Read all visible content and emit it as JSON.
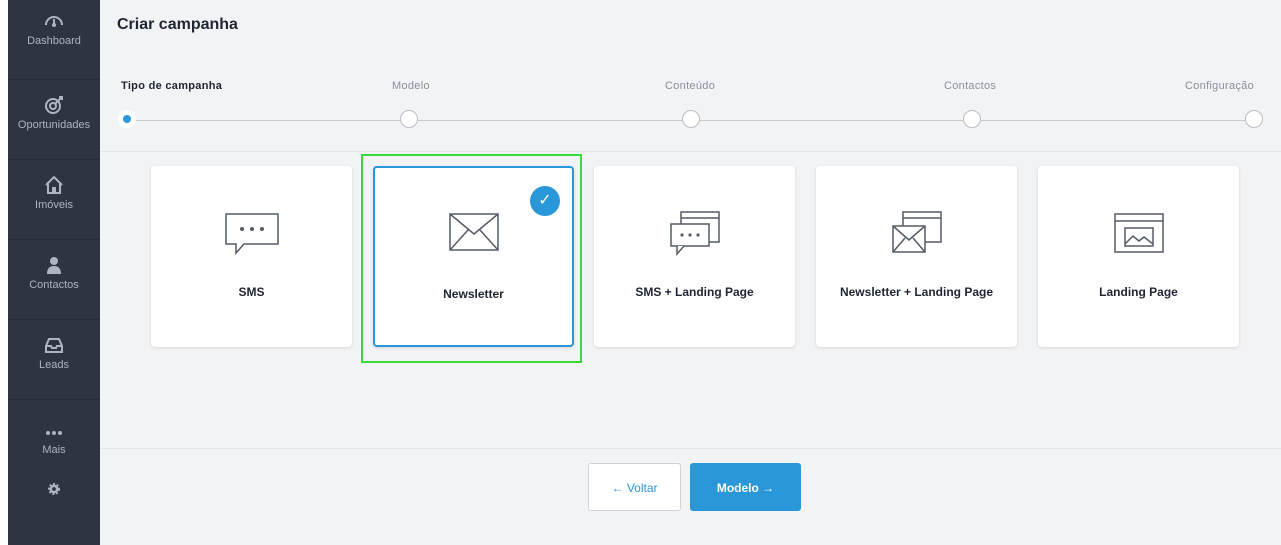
{
  "sidebar": {
    "items": [
      {
        "label": "Dashboard",
        "icon": "dashboard-gauge-icon"
      },
      {
        "label": "Oportunidades",
        "icon": "target-icon"
      },
      {
        "label": "Imóveis",
        "icon": "house-icon"
      },
      {
        "label": "Contactos",
        "icon": "person-icon"
      },
      {
        "label": "Leads",
        "icon": "inbox-icon"
      },
      {
        "label": "Mais",
        "icon": "more-dots-icon"
      }
    ],
    "settings_icon": "gear-icon"
  },
  "header": {
    "title": "Criar campanha"
  },
  "stepper": {
    "steps": [
      {
        "label": "Tipo de campanha",
        "active": true
      },
      {
        "label": "Modelo",
        "active": false
      },
      {
        "label": "Conteúdo",
        "active": false
      },
      {
        "label": "Contactos",
        "active": false
      },
      {
        "label": "Configuração",
        "active": false
      }
    ]
  },
  "campaign_types": [
    {
      "label": "SMS",
      "icon": "sms-chat-icon",
      "selected": false
    },
    {
      "label": "Newsletter",
      "icon": "envelope-icon",
      "selected": true
    },
    {
      "label": "SMS + Landing Page",
      "icon": "sms-landing-page-icon",
      "selected": false
    },
    {
      "label": "Newsletter + Landing Page",
      "icon": "newsletter-landing-page-icon",
      "selected": false
    },
    {
      "label": "Landing Page",
      "icon": "landing-page-icon",
      "selected": false
    }
  ],
  "actions": {
    "back_label": "← Voltar",
    "next_label": "Modelo →"
  },
  "colors": {
    "accent": "#2a97d8",
    "sidebar_bg": "#2e3442",
    "highlight": "#3ad83a"
  }
}
